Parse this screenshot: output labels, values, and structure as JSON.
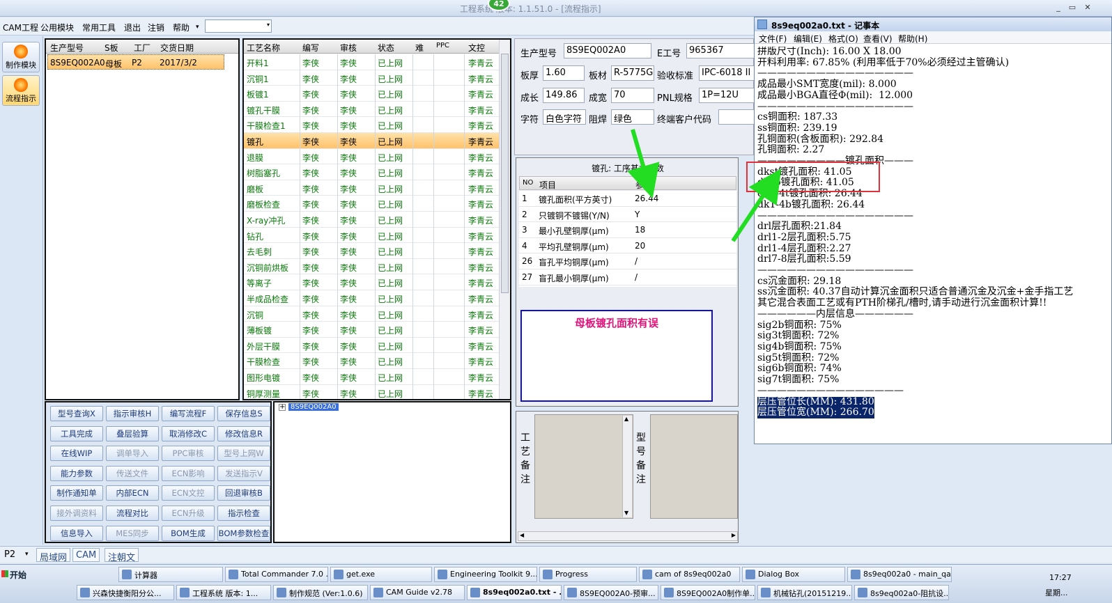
{
  "window": {
    "title": "工程系统  版本: 1.1.51.0 - [流程指示]",
    "badge": "42",
    "btn_min": "_",
    "btn_max": "▭",
    "btn_close": "✕"
  },
  "menu": {
    "items": [
      "CAM工程",
      "公用模块",
      "常用工具",
      "退出",
      "注销",
      "帮助"
    ],
    "dropdown_arrow": "▾",
    "combo_arrow": "▾"
  },
  "leftbar": {
    "btn1": "制作模块",
    "btn2": "流程指示"
  },
  "orders": {
    "headers": [
      "生产型号",
      "S板",
      "工厂",
      "交货日期"
    ],
    "rows": [
      [
        "8S9EQ002A0",
        "母板",
        "P2",
        "2017/3/2"
      ]
    ]
  },
  "process": {
    "headers": [
      "工艺名称",
      "编写",
      "审核",
      "状态",
      "难",
      "PPC",
      "文控"
    ],
    "rows": [
      [
        "开料1",
        "李侠",
        "李侠",
        "已上网",
        "",
        "",
        "李青云"
      ],
      [
        "沉铜1",
        "李侠",
        "李侠",
        "已上网",
        "",
        "",
        "李青云"
      ],
      [
        "板镀1",
        "李侠",
        "李侠",
        "已上网",
        "",
        "",
        "李青云"
      ],
      [
        "镀孔干膜",
        "李侠",
        "李侠",
        "已上网",
        "",
        "",
        "李青云"
      ],
      [
        "干膜检查1",
        "李侠",
        "李侠",
        "已上网",
        "",
        "",
        "李青云"
      ],
      [
        "镀孔",
        "李侠",
        "李侠",
        "已上网",
        "",
        "",
        "李青云"
      ],
      [
        "退膜",
        "李侠",
        "李侠",
        "已上网",
        "",
        "",
        "李青云"
      ],
      [
        "树脂塞孔",
        "李侠",
        "李侠",
        "已上网",
        "",
        "",
        "李青云"
      ],
      [
        "磨板",
        "李侠",
        "李侠",
        "已上网",
        "",
        "",
        "李青云"
      ],
      [
        "磨板检查",
        "李侠",
        "李侠",
        "已上网",
        "",
        "",
        "李青云"
      ],
      [
        "X-ray冲孔",
        "李侠",
        "李侠",
        "已上网",
        "",
        "",
        "李青云"
      ],
      [
        "钻孔",
        "李侠",
        "李侠",
        "已上网",
        "",
        "",
        "李青云"
      ],
      [
        "去毛刺",
        "李侠",
        "李侠",
        "已上网",
        "",
        "",
        "李青云"
      ],
      [
        "沉铜前烘板",
        "李侠",
        "李侠",
        "已上网",
        "",
        "",
        "李青云"
      ],
      [
        "等离子",
        "李侠",
        "李侠",
        "已上网",
        "",
        "",
        "李青云"
      ],
      [
        "半成品检查",
        "李侠",
        "李侠",
        "已上网",
        "",
        "",
        "李青云"
      ],
      [
        "沉铜",
        "李侠",
        "李侠",
        "已上网",
        "",
        "",
        "李青云"
      ],
      [
        "薄板镀",
        "李侠",
        "李侠",
        "已上网",
        "",
        "",
        "李青云"
      ],
      [
        "外层干膜",
        "李侠",
        "李侠",
        "已上网",
        "",
        "",
        "李青云"
      ],
      [
        "干膜检查",
        "李侠",
        "李侠",
        "已上网",
        "",
        "",
        "李青云"
      ],
      [
        "图形电镀",
        "李侠",
        "李侠",
        "已上网",
        "",
        "",
        "李青云"
      ],
      [
        "铜厚测量",
        "李侠",
        "李侠",
        "已上网",
        "",
        "",
        "李青云"
      ]
    ],
    "selected": 5
  },
  "buttons": [
    [
      "型号查询X",
      "指示审核H",
      "编写流程F",
      "保存信息S"
    ],
    [
      "工具完成",
      "叠层验算",
      "取消修改C",
      "修改信息R"
    ],
    [
      "在线WIP",
      "调单导入",
      "PPC审核",
      "型号上网W"
    ],
    [
      "能力参数",
      "传送文件",
      "ECN影响",
      "发送指示V"
    ],
    [
      "制作通知单",
      "内部ECN",
      "ECN文控",
      "回退审核B"
    ],
    [
      "接外调资料",
      "流程对比",
      "ECN升级",
      "指示检查"
    ],
    [
      "信息导入",
      "MES同步",
      "BOM生成",
      "BOM参数检查"
    ]
  ],
  "disabled_buttons": [
    "调单导入",
    "PPC审核",
    "型号上网W",
    "传送文件",
    "ECN影响",
    "发送指示V",
    "ECN文控",
    "接外调资料",
    "ECN升级",
    "MES同步"
  ],
  "tree": {
    "node": "8S9EQ002A0",
    "expander": "+"
  },
  "info": {
    "model_label": "生产型号",
    "model": "8S9EQ002A0",
    "e_label": "E工号",
    "e": "965367",
    "thick_label": "板厚",
    "thick": "1.60",
    "mat_label": "板材",
    "mat": "R-5775G",
    "std_label": "验收标准",
    "std": "IPC-6018 II",
    "len_label": "成长",
    "len": "149.86",
    "wid_label": "成宽",
    "wid": "70",
    "pnl_label": "PNL规格",
    "pnl": "1P=12U",
    "char_label": "字符",
    "char": "白色字符",
    "mask_label": "阻焊",
    "mask": "绿色",
    "cust_label": "终端客户代码",
    "cust": ""
  },
  "params": {
    "title": "镀孔: 工序基本参数",
    "headers": [
      "NO",
      "项目",
      "参数"
    ],
    "rows": [
      [
        "1",
        "镀孔面积(平方英寸)",
        "26.44"
      ],
      [
        "2",
        "只镀铜不镀锡(Y/N)",
        "Y"
      ],
      [
        "3",
        "最小孔壁铜厚(μm)",
        "18"
      ],
      [
        "4",
        "平均孔壁铜厚(μm)",
        "20"
      ],
      [
        "26",
        "盲孔平均铜厚(μm)",
        "/"
      ],
      [
        "27",
        "盲孔最小铜厚(μm)",
        "/"
      ]
    ]
  },
  "note": "母板镀孔面积有误",
  "remarks": {
    "craft": "工艺备注",
    "model": "型号备注",
    "scroll_up": "▲",
    "scroll_down": "▼",
    "hscroll_left": "◀",
    "hscroll_right": "▶"
  },
  "notepad": {
    "title": "8s9eq002a0.txt - 记事本",
    "menu": [
      "文件(F)",
      "编辑(E)",
      "格式(O)",
      "查看(V)",
      "帮助(H)"
    ],
    "lines": [
      "拼版尺寸(Inch): 16.00 X 18.00",
      "开料利用率: 67.85% (利用率低于70%必须经过主管确认)",
      "————————————————",
      "成品最小SMT宽度(mil): 8.000",
      "成品最小BGA直径Φ(mil):  12.000",
      "————————————————",
      "cs铜面积: 187.33",
      "ss铜面积: 239.19",
      "孔铜面积(含板面积): 292.84",
      "孔铜面积: 2.27",
      "—————————镀孔面积———",
      "dkst镀孔面积: 41.05",
      "dksb镀孔面积: 41.05",
      "dk1-4t镀孔面积: 26.44",
      "dk1-4b镀孔面积: 26.44",
      "",
      "————————————————",
      "drl层孔面积:21.84",
      "drl1-2层孔面积:5.75",
      "drl1-4层孔面积:2.27",
      "drl7-8层孔面积:5.59",
      "",
      "————————————————",
      "cs沉金面积: 29.18",
      "ss沉金面积: 40.37自动计算沉金面积只适合普通沉金及沉金+金手指工艺",
      "其它混合表面工艺或有PTH阶梯孔/槽时,请手动进行沉金面积计算!!",
      "——————内层信息——————",
      "sig2b铜面积: 75%",
      "sig3t铜面积: 72%",
      "sig4b铜面积: 75%",
      "sig5t铜面积: 72%",
      "sig6b铜面积: 74%",
      "sig7t铜面积: 75%",
      "———————————————",
      "层压管位长(MM): 431.80",
      "层压管位宽(MM): 266.70"
    ]
  },
  "statusbar": {
    "combo": "P2",
    "combo_arrow": "▾",
    "tabs": [
      "局域网",
      "CAM",
      "注朝文"
    ]
  },
  "taskbar": {
    "start": "开始",
    "row1": [
      "计算器",
      "Total Commander 7.0 ...",
      "get.exe",
      "Engineering Toolkit 9....",
      "Progress",
      "cam of 8s9eq002a0",
      "Dialog Box",
      "8s9eq002a0 - main_qa"
    ],
    "row2": [
      "兴森快捷衡阳分公...",
      "工程系统 版本: 1...",
      "制作规范 (Ver:1.0.6)",
      "CAM Guide v2.78",
      "8s9eq002a0.txt - ...",
      "8S9EQ002A0-预审...",
      "8S9EQ002A0制作单...",
      "机械钻孔(20151219...",
      "8s9eq002a0-阻抗设..."
    ],
    "time": "17:27",
    "day": "星期..."
  },
  "colors": {
    "green_arrow": "#22dd22",
    "red_box": "#e0303a",
    "blue_box": "#1010c8",
    "note_text": "#e0147a"
  }
}
